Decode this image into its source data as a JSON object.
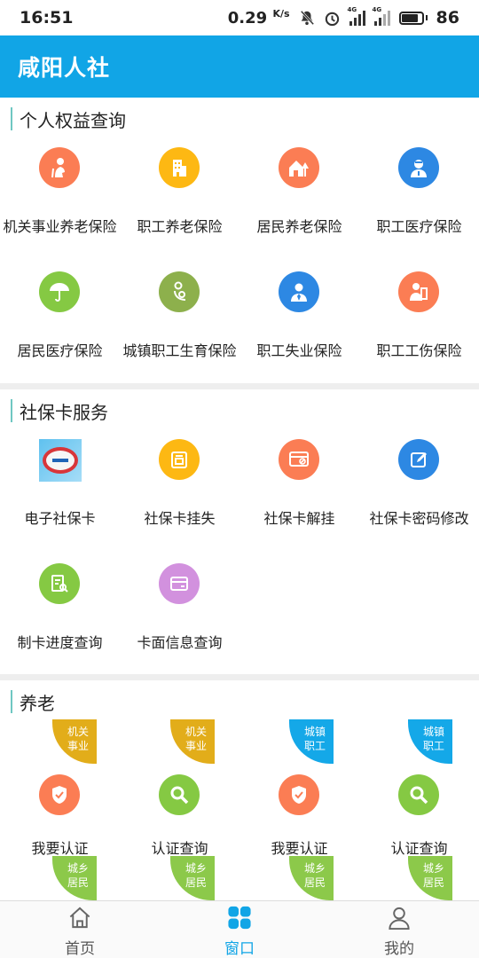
{
  "status_bar": {
    "time": "16:51",
    "speed": "0.29",
    "speed_unit": "K/s",
    "net1": "4G",
    "net2": "4G",
    "battery": "86"
  },
  "header": {
    "title": "咸阳人社"
  },
  "sections": {
    "personal": {
      "title": "个人权益查询",
      "items": [
        {
          "label": "机关事业养老保险",
          "icon": "elderly-person-icon",
          "color": "#fb7d54"
        },
        {
          "label": "职工养老保险",
          "icon": "building-icon",
          "color": "#fdb813"
        },
        {
          "label": "居民养老保险",
          "icon": "house-tree-icon",
          "color": "#fb7d54"
        },
        {
          "label": "职工医疗保险",
          "icon": "doctor-icon",
          "color": "#2d88e3"
        },
        {
          "label": "居民医疗保险",
          "icon": "umbrella-icon",
          "color": "#85c943"
        },
        {
          "label": "城镇职工生育保险",
          "icon": "mother-baby-icon",
          "color": "#8db04c"
        },
        {
          "label": "职工失业保险",
          "icon": "worker-icon",
          "color": "#2d88e3"
        },
        {
          "label": "职工工伤保险",
          "icon": "injured-worker-icon",
          "color": "#fb7d54"
        }
      ]
    },
    "card": {
      "title": "社保卡服务",
      "items": [
        {
          "label": "电子社保卡",
          "icon": "social-security-card-logo-icon",
          "color": "#5fc1ef"
        },
        {
          "label": "社保卡挂失",
          "icon": "card-report-loss-icon",
          "color": "#fdb813"
        },
        {
          "label": "社保卡解挂",
          "icon": "card-unlock-icon",
          "color": "#fb7d54"
        },
        {
          "label": "社保卡密码修改",
          "icon": "edit-password-icon",
          "color": "#2d88e3"
        },
        {
          "label": "制卡进度查询",
          "icon": "progress-search-icon",
          "color": "#85c943"
        },
        {
          "label": "卡面信息查询",
          "icon": "card-info-icon",
          "color": "#d291de"
        }
      ]
    },
    "pension": {
      "title": "养老",
      "items": [
        {
          "label": "我要认证",
          "icon": "shield-check-icon",
          "color": "#fb7d54",
          "badge_line1": "机关",
          "badge_line2": "事业",
          "badge_color": "#e2ad1a"
        },
        {
          "label": "认证查询",
          "icon": "magnifier-icon",
          "color": "#85c943",
          "badge_line1": "机关",
          "badge_line2": "事业",
          "badge_color": "#e2ad1a"
        },
        {
          "label": "我要认证",
          "icon": "shield-check-icon",
          "color": "#fb7d54",
          "badge_line1": "城镇",
          "badge_line2": "职工",
          "badge_color": "#14a8e8"
        },
        {
          "label": "认证查询",
          "icon": "magnifier-icon",
          "color": "#85c943",
          "badge_line1": "城镇",
          "badge_line2": "职工",
          "badge_color": "#14a8e8"
        }
      ],
      "next_row_badges": [
        {
          "line1": "城乡",
          "line2": "居民",
          "color": "#8cc94a"
        },
        {
          "line1": "城乡",
          "line2": "居民",
          "color": "#8cc94a"
        },
        {
          "line1": "城乡",
          "line2": "居民",
          "color": "#8cc94a"
        },
        {
          "line1": "城乡",
          "line2": "居民",
          "color": "#8cc94a"
        }
      ]
    }
  },
  "bottom_nav": {
    "home": "首页",
    "window": "窗口",
    "mine": "我的",
    "active": "window",
    "active_color": "#11a5e6"
  }
}
